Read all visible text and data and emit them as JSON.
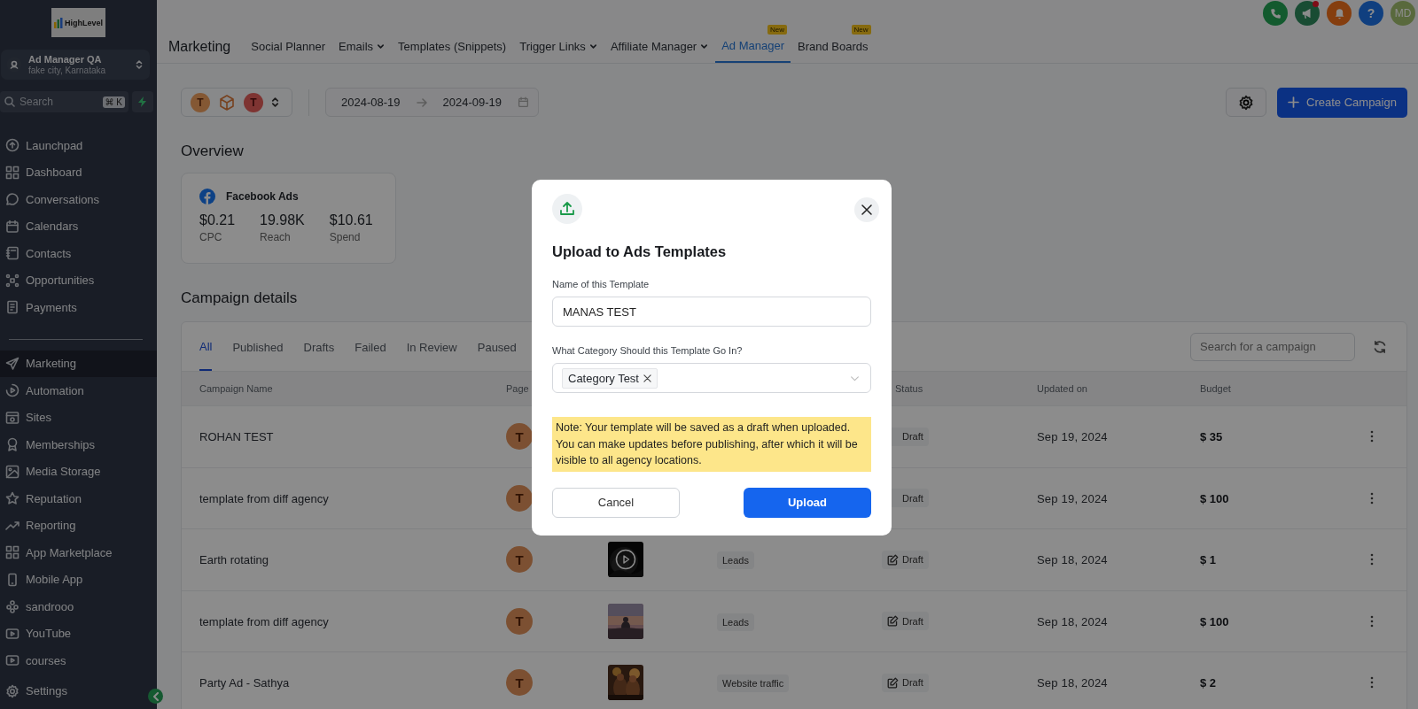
{
  "sidebar": {
    "logo_text": "HighLevel",
    "account": {
      "name": "Ad Manager QA",
      "location": "fake city, Karnataka"
    },
    "search": {
      "placeholder": "Search",
      "shortcut": "⌘ K"
    },
    "sections": [
      {
        "items": [
          {
            "label": "Launchpad",
            "selected": false
          },
          {
            "label": "Dashboard",
            "selected": false
          },
          {
            "label": "Conversations",
            "selected": false
          },
          {
            "label": "Calendars",
            "selected": false
          },
          {
            "label": "Contacts",
            "selected": false
          },
          {
            "label": "Opportunities",
            "selected": false
          },
          {
            "label": "Payments",
            "selected": false
          }
        ]
      },
      {
        "items": [
          {
            "label": "Marketing",
            "selected": true
          },
          {
            "label": "Automation",
            "selected": false
          },
          {
            "label": "Sites",
            "selected": false
          },
          {
            "label": "Memberships",
            "selected": false
          },
          {
            "label": "Media Storage",
            "selected": false
          },
          {
            "label": "Reputation",
            "selected": false
          },
          {
            "label": "Reporting",
            "selected": false
          },
          {
            "label": "App Marketplace",
            "selected": false
          },
          {
            "label": "Mobile App",
            "selected": false
          },
          {
            "label": "sandrooo",
            "selected": false
          },
          {
            "label": "YouTube",
            "selected": false
          },
          {
            "label": "courses",
            "selected": false
          }
        ]
      }
    ],
    "settings": {
      "label": "Settings"
    }
  },
  "top_bar": {
    "notification_dot": true,
    "help": "?",
    "avatar": "MD"
  },
  "header": {
    "title": "Marketing",
    "nav": [
      {
        "label": "Social Planner",
        "selected": false,
        "dropdown": false
      },
      {
        "label": "Emails",
        "selected": false,
        "dropdown": true
      },
      {
        "label": "Templates (Snippets)",
        "selected": false,
        "dropdown": false
      },
      {
        "label": "Trigger Links",
        "selected": false,
        "dropdown": true
      },
      {
        "label": "Affiliate Manager",
        "selected": false,
        "dropdown": true
      },
      {
        "label": "Ad Manager",
        "selected": true,
        "dropdown": false,
        "badge": "New"
      },
      {
        "label": "Brand Boards",
        "selected": false,
        "dropdown": false,
        "badge": "New"
      }
    ]
  },
  "toolbar": {
    "accounts": [
      {
        "kind": "letter",
        "letter": "T"
      },
      {
        "kind": "logo"
      },
      {
        "kind": "letter-alt",
        "letter": "T"
      }
    ],
    "date_start": "2024-08-19",
    "date_end": "2024-09-19",
    "create_button": "Create Campaign"
  },
  "overview": {
    "title": "Overview",
    "card": {
      "platform": "Facebook Ads",
      "metrics": [
        {
          "value": "$0.21",
          "label": "CPC"
        },
        {
          "value": "19.98K",
          "label": "Reach"
        },
        {
          "value": "$10.61",
          "label": "Spend"
        }
      ]
    }
  },
  "campaigns": {
    "title": "Campaign details",
    "tabs": [
      {
        "label": "All",
        "selected": true
      },
      {
        "label": "Published",
        "selected": false
      },
      {
        "label": "Drafts",
        "selected": false
      },
      {
        "label": "Failed",
        "selected": false
      },
      {
        "label": "In Review",
        "selected": false
      },
      {
        "label": "Paused",
        "selected": false
      }
    ],
    "search_placeholder": "Search for a campaign",
    "columns": {
      "name": "Campaign Name",
      "page": "Page",
      "status": "Status",
      "updated": "Updated on",
      "budget": "Budget"
    },
    "rows": [
      {
        "name": "ROHAN TEST",
        "page": "T",
        "status": "Draft",
        "updated": "Sep 19, 2024",
        "budget": "$ 35"
      },
      {
        "name": "template from diff agency",
        "page": "T",
        "status": "Draft",
        "updated": "Sep 19, 2024",
        "budget": "$ 100"
      },
      {
        "name": "Earth rotating",
        "page": "T",
        "thumbnail": {
          "kind": "video"
        },
        "objective": "Leads",
        "status": "Draft",
        "updated": "Sep 18, 2024",
        "budget": "$ 1"
      },
      {
        "name": "template from diff agency",
        "page": "T",
        "thumbnail": {
          "kind": "dusk"
        },
        "objective": "Leads",
        "status": "Draft",
        "updated": "Sep 18, 2024",
        "budget": "$ 100"
      },
      {
        "name": "Party Ad - Sathya",
        "page": "T",
        "thumbnail": {
          "kind": "party"
        },
        "objective": "Website traffic",
        "status": "Draft",
        "updated": "Sep 18, 2024",
        "budget": "$ 2"
      }
    ]
  },
  "modal": {
    "title": "Upload to Ads Templates",
    "name_label": "Name of this Template",
    "name_value": "MANAS TEST",
    "category_label": "What Category Should this Template Go In?",
    "categories": [
      "Category Test"
    ],
    "note": "Note: Your template will be saved as a draft when uploaded. You can make updates before publishing, after which it will be visible to all agency locations.",
    "cancel": "Cancel",
    "upload": "Upload"
  }
}
